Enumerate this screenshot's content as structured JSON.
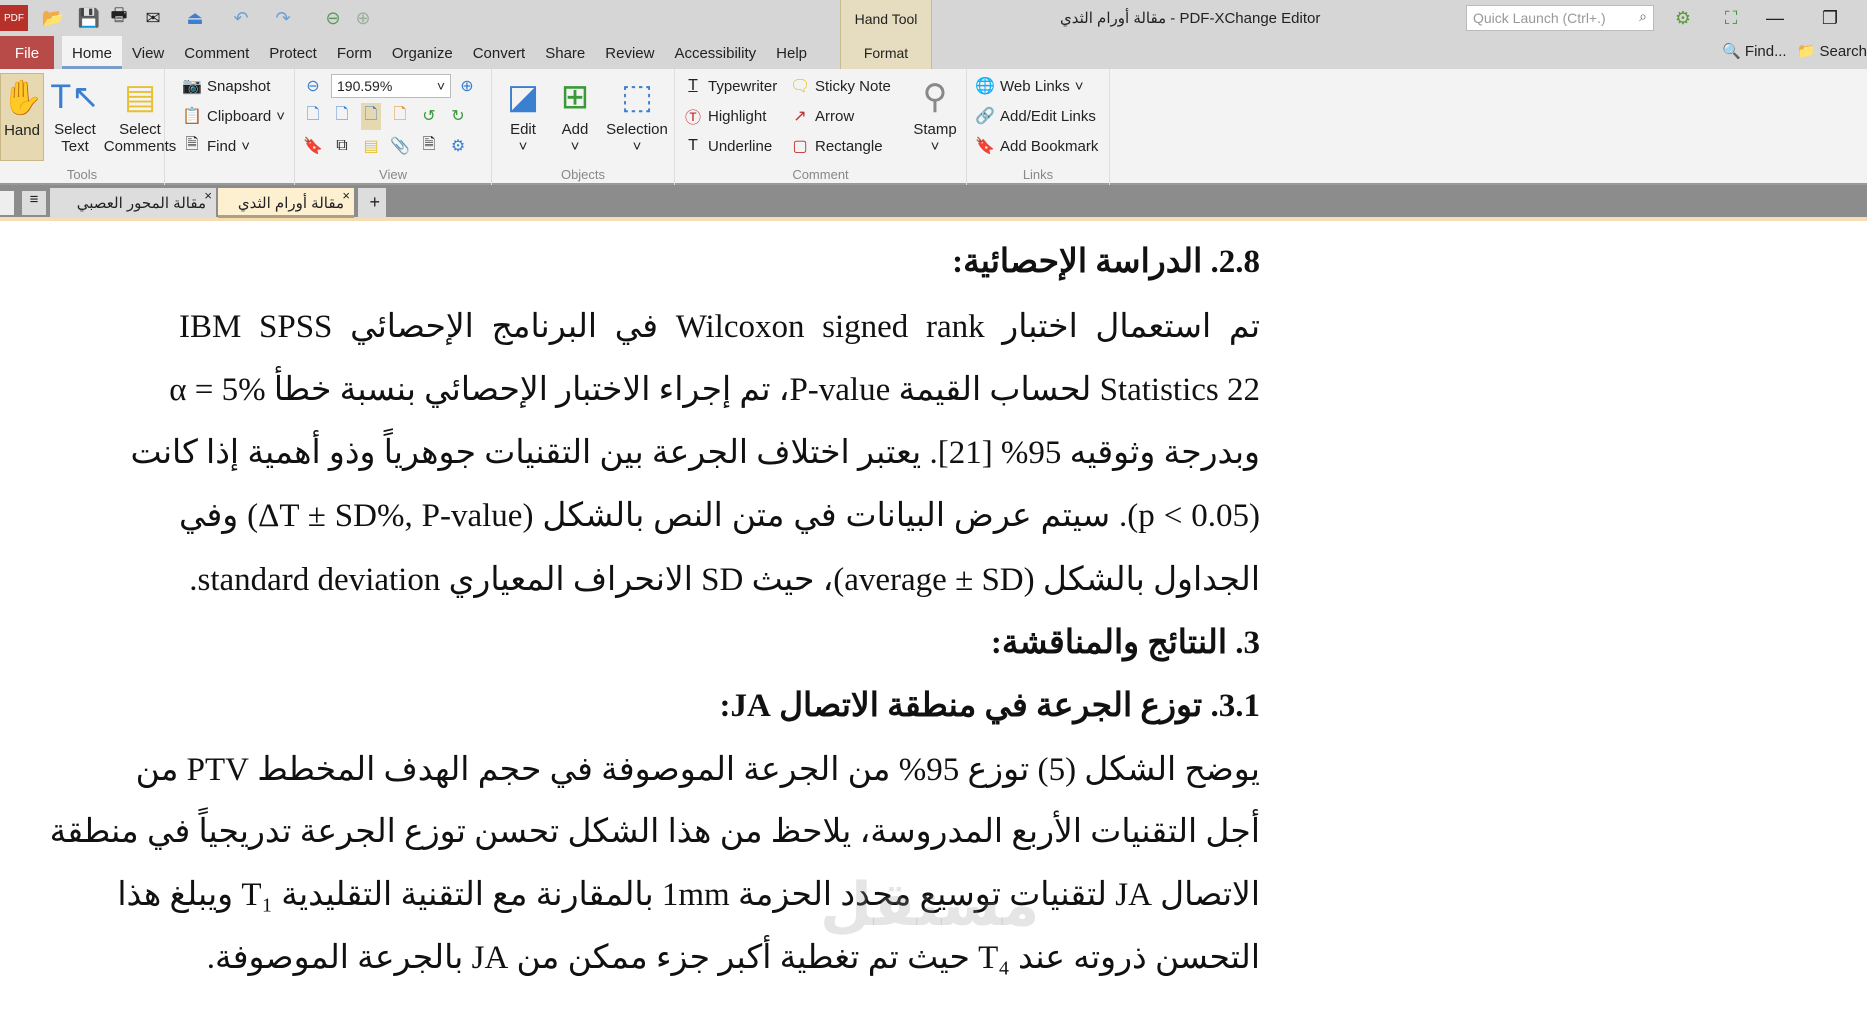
{
  "app": {
    "title": "مقالة أورام الثدي - PDF-XChange Editor",
    "quick_launch_placeholder": "Quick Launch (Ctrl+.)",
    "find": "Find...",
    "search": "Search"
  },
  "context_tab": {
    "group": "Hand Tool",
    "tab": "Format"
  },
  "menu": [
    "File",
    "Home",
    "View",
    "Comment",
    "Protect",
    "Form",
    "Organize",
    "Convert",
    "Share",
    "Review",
    "Accessibility",
    "Help"
  ],
  "ribbon": {
    "tools": {
      "label": "Tools",
      "hand": "Hand",
      "select_text": "Select Text",
      "select_comments": "Select Comments",
      "snapshot": "Snapshot",
      "clipboard": "Clipboard",
      "find": "Find"
    },
    "view": {
      "label": "View",
      "zoom": "190.59%"
    },
    "objects": {
      "label": "Objects",
      "edit": "Edit",
      "add": "Add",
      "selection": "Selection"
    },
    "comment": {
      "label": "Comment",
      "typewriter": "Typewriter",
      "sticky_note": "Sticky Note",
      "highlight": "Highlight",
      "arrow": "Arrow",
      "underline": "Underline",
      "rectangle": "Rectangle",
      "stamp": "Stamp"
    },
    "links": {
      "label": "Links",
      "web_links": "Web Links",
      "add_edit_links": "Add/Edit Links",
      "add_bookmark": "Add Bookmark"
    }
  },
  "doc_tabs": [
    {
      "label": "مقالة المحور العصبي"
    },
    {
      "label": "مقالة أورام الثدي",
      "active": true
    }
  ],
  "document": {
    "lines": [
      "2.8. الدراسة الإحصائية:",
      "تم استعمال اختبار Wilcoxon signed rank في البرنامج الإحصائي IBM SPSS",
      "Statistics 22 لحساب القيمة P-value، تم إجراء الاختبار الإحصائي بنسبة خطأ α = 5%",
      "وبدرجة وثوقيه 95% [21]. يعتبر اختلاف الجرعة بين التقنيات جوهرياً وذو أهمية إذا كانت",
      "(p < 0.05). سيتم عرض البيانات في متن النص بالشكل (ΔT ± SD%, P-value) وفي",
      "الجداول بالشكل (average ± SD)، حيث SD الانحراف المعياري standard deviation.",
      "3.   النتائج والمناقشة:",
      "3.1.  توزع الجرعة في منطقة الاتصال JA:",
      "يوضح الشكل (5) توزع 95% من الجرعة الموصوفة في حجم الهدف المخطط PTV من",
      "أجل التقنيات الأربع المدروسة، يلاحظ من هذا الشكل تحسن توزع الجرعة تدريجياً في منطقة",
      "الاتصال JA لتقنيات توسيع محدد الحزمة 1mm بالمقارنة مع التقنية التقليدية T₁ ويبلغ هذا",
      "التحسن ذروته عند T₄ حيث تم تغطية أكبر جزء ممكن من JA بالجرعة الموصوفة."
    ],
    "watermark": "مستقل mostaql.com"
  }
}
